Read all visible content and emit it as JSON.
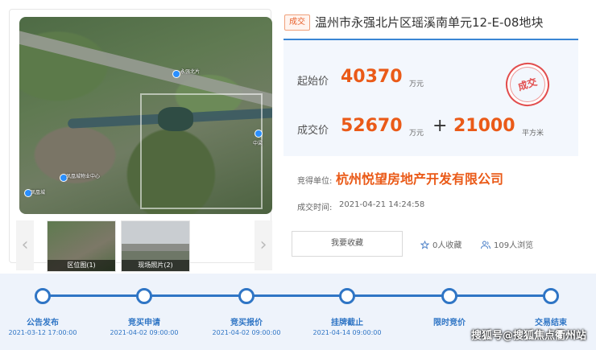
{
  "status_badge": "成交",
  "title": "温州市永强北片区瑶溪南单元12-E-08地块",
  "start_price": {
    "label": "起始价",
    "value": "40370",
    "unit": "万元"
  },
  "deal_price": {
    "label": "成交价",
    "value": "52670",
    "unit": "万元",
    "plus": "+",
    "extra_value": "21000",
    "extra_unit": "平方米"
  },
  "stamp": "成交",
  "winner": {
    "label": "竞得单位:",
    "name": "杭州悦望房地产开发有限公司"
  },
  "deal_time": {
    "label": "成交时间:",
    "value": "2021-04-21 14:24:58"
  },
  "favorite_button": "我要收藏",
  "stats": {
    "favorites": "0人收藏",
    "views": "109人浏览"
  },
  "thumbnails": [
    {
      "caption": "区位图(1)"
    },
    {
      "caption": "现场照片(2)"
    }
  ],
  "map_labels": [
    "永强北片",
    "中梁",
    "凤凰城物业中心",
    "凤凰城"
  ],
  "timeline": [
    {
      "step": "公告发布",
      "date": "2021-03-12 17:00:00"
    },
    {
      "step": "竞买申请",
      "date": "2021-04-02 09:00:00"
    },
    {
      "step": "竞买报价",
      "date": "2021-04-02 09:00:00"
    },
    {
      "step": "挂牌截止",
      "date": "2021-04-14 09:00:00"
    },
    {
      "step": "限时竞价",
      "date": ""
    },
    {
      "step": "交易结束",
      "date": ""
    }
  ],
  "watermark": "搜狐号@搜狐焦点衢州站",
  "colors": {
    "accent": "#ea5a18",
    "primary": "#2f75c5",
    "stamp": "#e24d4d"
  },
  "icons": {
    "left_arrow": "chevron-left-icon",
    "right_arrow": "chevron-right-icon",
    "favorite": "star-icon",
    "views": "users-icon"
  }
}
